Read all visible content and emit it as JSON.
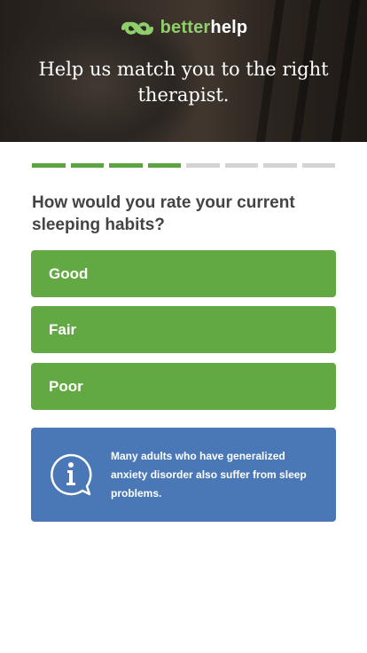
{
  "header": {
    "logo_prefix": "better",
    "logo_suffix": "help",
    "title": "Help us match you to the right therapist."
  },
  "progress": {
    "steps_completed": 4,
    "steps_total": 8
  },
  "question": {
    "text": "How would you rate your current sleeping habits?"
  },
  "options": [
    {
      "label": "Good"
    },
    {
      "label": "Fair"
    },
    {
      "label": "Poor"
    }
  ],
  "info_box": {
    "icon": "info-icon",
    "text": "Many adults who have generalized anxiety disorder also suffer from sleep problems."
  },
  "colors": {
    "option_green": "#62a843",
    "progress_done": "#5aa540",
    "progress_todo": "#d3d3d3",
    "info_blue": "#4a78b6"
  }
}
